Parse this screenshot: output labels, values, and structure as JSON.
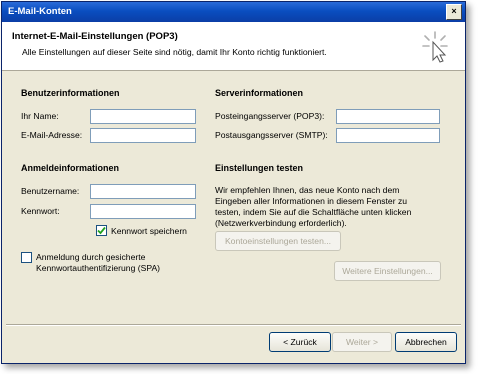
{
  "window": {
    "title": "E-Mail-Konten",
    "close_label": "×"
  },
  "header": {
    "title": "Internet-E-Mail-Einstellungen (POP3)",
    "subtitle": "Alle Einstellungen auf dieser Seite sind nötig, damit Ihr Konto richtig funktioniert."
  },
  "user_info": {
    "heading": "Benutzerinformationen",
    "name_label": "Ihr Name:",
    "name_value": "",
    "email_label": "E-Mail-Adresse:",
    "email_value": ""
  },
  "server_info": {
    "heading": "Serverinformationen",
    "incoming_label": "Posteingangsserver (POP3):",
    "incoming_value": "",
    "outgoing_label": "Postausgangsserver (SMTP):",
    "outgoing_value": ""
  },
  "login_info": {
    "heading": "Anmeldeinformationen",
    "username_label": "Benutzername:",
    "username_value": "",
    "password_label": "Kennwort:",
    "password_value": "",
    "remember_label": "Kennwort speichern",
    "remember_checked": true,
    "spa_label_1": "Anmeldung durch gesicherte",
    "spa_label_2": "Kennwortauthentifizierung (SPA)",
    "spa_checked": false
  },
  "test_settings": {
    "heading": "Einstellungen testen",
    "text": "Wir empfehlen Ihnen, das neue Konto nach dem Eingeben aller Informationen in diesem Fenster zu testen, indem Sie auf die Schaltfläche unten klicken (Netzwerkverbindung erforderlich).",
    "test_button": "Kontoeinstellungen testen..."
  },
  "more_button": "Weitere Einstellungen...",
  "footer": {
    "back": "< Zurück",
    "next": "Weiter >",
    "cancel": "Abbrechen"
  }
}
